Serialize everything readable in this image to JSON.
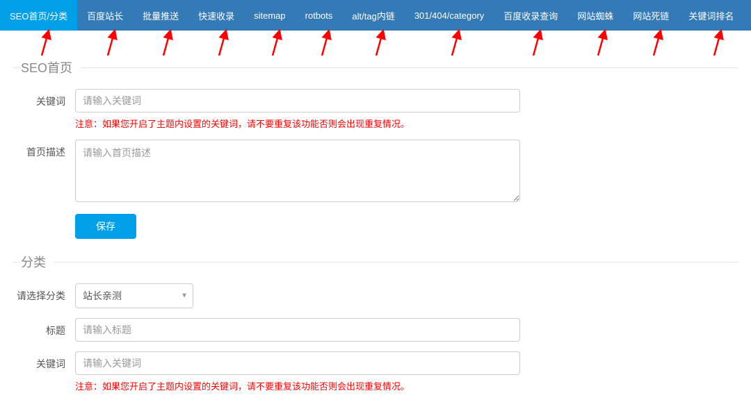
{
  "nav": {
    "items": [
      {
        "label": "SEO首页/分类",
        "active": true
      },
      {
        "label": "百度站长"
      },
      {
        "label": "批量推送"
      },
      {
        "label": "快速收录"
      },
      {
        "label": "sitemap"
      },
      {
        "label": "rotbots"
      },
      {
        "label": "alt/tag内链"
      },
      {
        "label": "301/404/category"
      },
      {
        "label": "百度收录查询"
      },
      {
        "label": "网站蜘蛛"
      },
      {
        "label": "网站死链"
      },
      {
        "label": "关键词排名"
      }
    ]
  },
  "section1": {
    "legend": "SEO首页",
    "keyword_label": "关键词",
    "keyword_placeholder": "请输入关键词",
    "keyword_warn": "注意：如果您开启了主题内设置的关键词，请不要重复该功能否则会出现重复情况。",
    "desc_label": "首页描述",
    "desc_placeholder": "请输入首页描述",
    "save_label": "保存"
  },
  "section2": {
    "legend": "分类",
    "cat_label": "请选择分类",
    "cat_value": "站长亲测",
    "title_label": "标题",
    "title_placeholder": "请输入标题",
    "keyword_label": "关键词",
    "keyword_placeholder": "请输入关键词",
    "keyword_warn": "注意：如果您开启了主题内设置的关键词，请不要重复该功能否则会出现重复情况。"
  },
  "annotation": {
    "arrow_color": "#ff0000"
  }
}
